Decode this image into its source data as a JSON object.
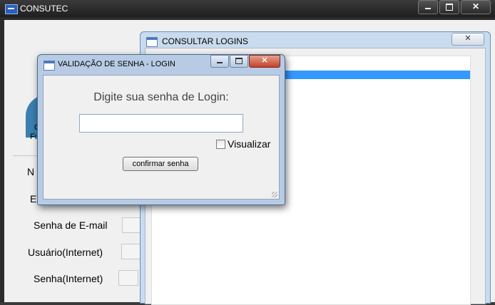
{
  "main_window": {
    "title": "CONSUTEC",
    "avatar_caption_line1": "C",
    "avatar_caption_line2": "Fu",
    "form_labels": [
      "N",
      "E",
      "Senha de E-mail",
      "Usuário(Internet)",
      "Senha(Internet)"
    ]
  },
  "consultar_logins": {
    "title": "CONSULTAR LOGINS"
  },
  "validation_dialog": {
    "title": "VALIDAÇÃO DE SENHA - LOGIN",
    "prompt": "Digite sua senha de Login:",
    "password_value": "",
    "checkbox_label": "Visualizar",
    "checkbox_checked": false,
    "confirm_label": "confirmar senha"
  },
  "icons": {
    "app": "app-icon",
    "window": "window-icon",
    "minimize": "minimize-icon",
    "maximize": "maximize-icon",
    "close": "close-icon"
  },
  "colors": {
    "selection": "#3399ff",
    "close_button": "#c2412a",
    "dark_titlebar": "#1f1f1f"
  }
}
